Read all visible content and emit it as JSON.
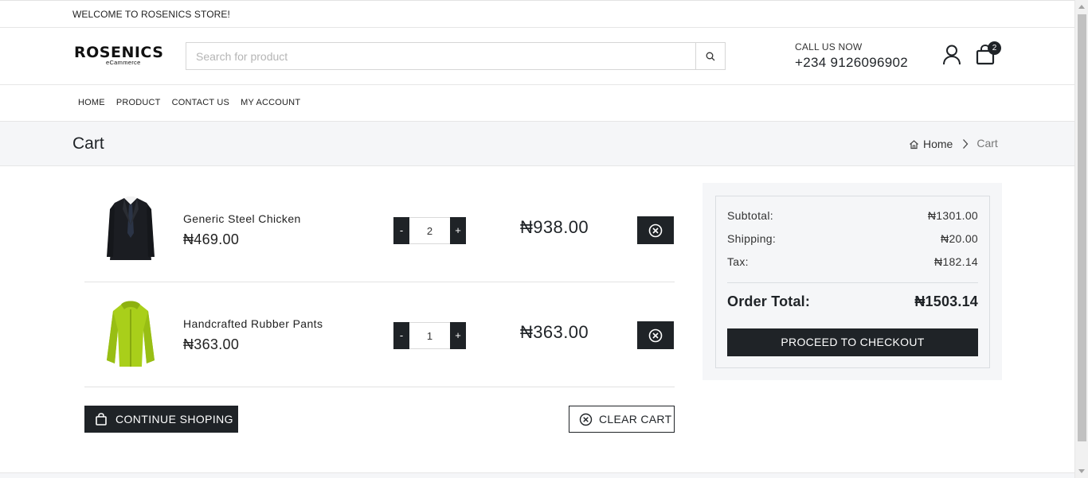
{
  "topbar": {
    "welcome": "WELCOME TO ROSENICS STORE!"
  },
  "header": {
    "logo_main": "ROSENICS",
    "logo_sub": "eCammerce",
    "search_placeholder": "Search for product",
    "call_label": "CALL US NOW",
    "phone": "+234 9126096902",
    "cart_count": "2"
  },
  "nav": {
    "items": [
      "HOME",
      "PRODUCT",
      "CONTACT US",
      "MY ACCOUNT"
    ]
  },
  "page": {
    "title": "Cart",
    "breadcrumb": {
      "home": "Home",
      "current": "Cart"
    }
  },
  "cart": {
    "items": [
      {
        "name": "Generic Steel Chicken",
        "price": "₦469.00",
        "qty": "2",
        "total": "₦938.00",
        "image": "black-suit"
      },
      {
        "name": "Handcrafted Rubber Pants",
        "price": "₦363.00",
        "qty": "1",
        "total": "₦363.00",
        "image": "lime-jacket"
      }
    ],
    "minus": "-",
    "plus": "+",
    "continue_label": "CONTINUE SHOPING",
    "clear_label": "CLEAR CART"
  },
  "summary": {
    "subtotal_label": "Subtotal:",
    "subtotal": "₦1301.00",
    "shipping_label": "Shipping:",
    "shipping": "₦20.00",
    "tax_label": "Tax:",
    "tax": "₦182.14",
    "total_label": "Order Total:",
    "total": "₦1503.14",
    "checkout_label": "PROCEED TO CHECKOUT"
  },
  "colors": {
    "dark": "#1f2327",
    "band": "#f5f6f8",
    "border": "#e6e6e6"
  }
}
